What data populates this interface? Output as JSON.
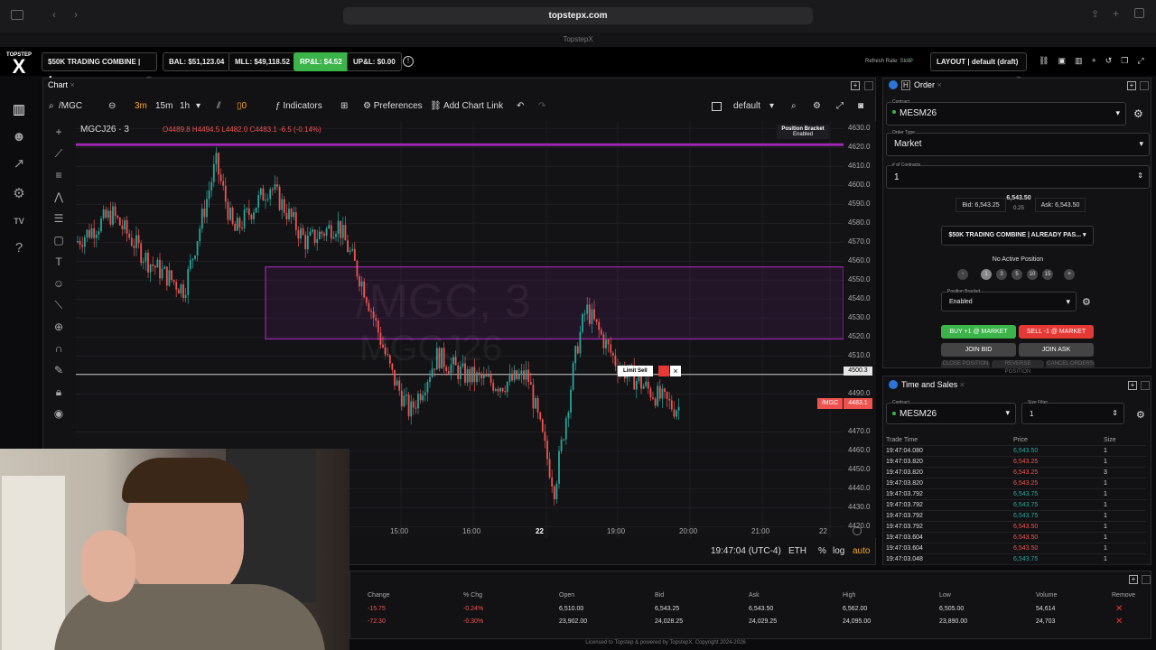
{
  "browser": {
    "url": "topstepx.com",
    "tab_title": "TopstepX"
  },
  "topbar": {
    "logo_top": "TOPSTEP",
    "logo_bottom": "X",
    "account": "$50K TRADING COMBINE | A...",
    "bal": "BAL: $51,123.04",
    "mll": "MLL: $49,118.52",
    "rpnl": "RP&L: $4.52",
    "upnl": "UP&L: $0.00",
    "refresh": "Refresh Rate: Slow",
    "layout": "LAYOUT | default (draft)"
  },
  "chart": {
    "tab": "Chart",
    "symbol": "/MGC",
    "intervals": [
      "3m",
      "15m",
      "1h"
    ],
    "indicators": "Indicators",
    "preferences": "Preferences",
    "chart_link": "Add Chart Link",
    "template": "default",
    "title": "MGCJ26 · 3",
    "ohlc": "O4489.8 H4494.5 L4482.0 C4483.1 -6.5 (-0.14%)",
    "bracket_title": "Position Bracket",
    "bracket_state": "Enabled",
    "watermark1": "/MGC, 3",
    "watermark2": "MGCJ26",
    "limit_label": "Limit Sell",
    "limit_price": "4500.3",
    "last_tag": "/MGC",
    "last_price": "4483.1",
    "price_ticks": [
      "4630.0",
      "4620.0",
      "4610.0",
      "4600.0",
      "4590.0",
      "4580.0",
      "4570.0",
      "4560.0",
      "4550.0",
      "4540.0",
      "4530.0",
      "4520.0",
      "4510.0",
      "4490.0",
      "4470.0",
      "4460.0",
      "4450.0",
      "4440.0",
      "4430.0",
      "4420.0"
    ],
    "time_ticks": [
      "15:00",
      "16:00",
      "22",
      "19:00",
      "20:00",
      "21:00",
      "22"
    ],
    "clock": "19:47:04 (UTC-4)",
    "session": "ETH",
    "pct": "%",
    "log": "log",
    "auto": "auto"
  },
  "order": {
    "tab": "Order",
    "contract_label": "Contract",
    "contract": "MESM26",
    "type_label": "Order Type",
    "type": "Market",
    "qty_label": "# of Contracts",
    "qty": "1",
    "bid": "Bid: 6,543.25",
    "last": "6,543.50",
    "spread": "0.25",
    "ask": "Ask: 6,543.50",
    "account": "$50K TRADING COMBINE | ALREADY PAS...",
    "no_position": "No Active Position",
    "qty_presets": [
      "1",
      "3",
      "5",
      "10",
      "15"
    ],
    "bracket_label": "Position Bracket",
    "bracket": "Enabled",
    "buy": "BUY +1 @ MARKET",
    "sell": "SELL -1 @ MARKET",
    "join_bid": "JOIN BID",
    "join_ask": "JOIN ASK",
    "close": "CLOSE POSITION",
    "reverse": "REVERSE POSITION",
    "cancel": "CANCEL ORDERS"
  },
  "tas": {
    "tab": "Time and Sales",
    "contract_label": "Contract",
    "contract": "MESM26",
    "size_label": "Size Filter",
    "size": "1",
    "headers": [
      "Trade Time",
      "Price",
      "Size"
    ],
    "rows": [
      [
        "19:47:04.080",
        "6,543.50",
        "1",
        "g"
      ],
      [
        "19:47:03.820",
        "6,543.25",
        "1",
        "r"
      ],
      [
        "19:47:03.820",
        "6,543.25",
        "3",
        "r"
      ],
      [
        "19:47:03.820",
        "6,543.25",
        "1",
        "r"
      ],
      [
        "19:47:03.792",
        "6,543.75",
        "1",
        "g"
      ],
      [
        "19:47:03.792",
        "6,543.75",
        "1",
        "g"
      ],
      [
        "19:47:03.792",
        "6,543.75",
        "1",
        "g"
      ],
      [
        "19:47:03.792",
        "6,543.50",
        "1",
        "r"
      ],
      [
        "19:47:03.604",
        "6,543.50",
        "1",
        "r"
      ],
      [
        "19:47:03.604",
        "6,543.50",
        "1",
        "r"
      ],
      [
        "19:47:03.048",
        "6,543.75",
        "1",
        "g"
      ]
    ]
  },
  "watchlist": {
    "headers": [
      "Change",
      "% Chg",
      "Open",
      "Bid",
      "Ask",
      "High",
      "Low",
      "Volume",
      "Remove"
    ],
    "rows": [
      [
        "-15.75",
        "-0.24%",
        "6,510.00",
        "6,543.25",
        "6,543.50",
        "6,562.00",
        "6,505.00",
        "54,614"
      ],
      [
        "-72.30",
        "-0.30%",
        "23,902.00",
        "24,028.25",
        "24,029.25",
        "24,095.00",
        "23,890.00",
        "24,703"
      ]
    ]
  },
  "footer": "Licensed to Topstep & powered by TopstepX. Copyright 2024-2026",
  "colors": {
    "up": "#26a69a",
    "down": "#ef5350",
    "zone": "#9c27b0",
    "buy": "#3bb54a",
    "sell": "#e53935"
  }
}
